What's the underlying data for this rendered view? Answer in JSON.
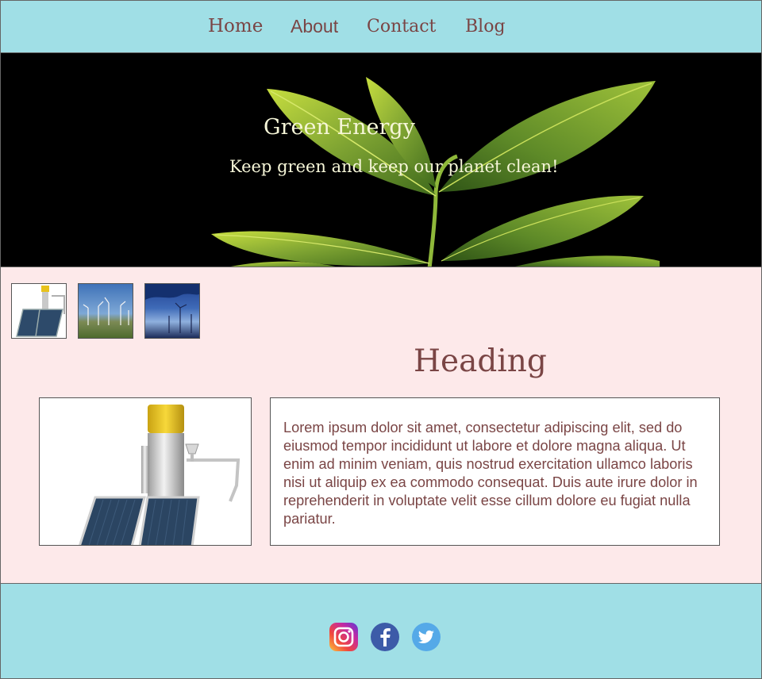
{
  "nav": {
    "items": [
      {
        "label": "Home"
      },
      {
        "label": "About"
      },
      {
        "label": "Contact"
      },
      {
        "label": "Blog"
      }
    ]
  },
  "hero": {
    "title": "Green Energy",
    "subtitle": "Keep green and keep our planet clean!",
    "colors": {
      "background": "#000000",
      "leaf": "#7aa02c",
      "text": "#f6f6d8"
    }
  },
  "gallery": {
    "thumbnails": [
      {
        "icon": "solar-water-heater-image"
      },
      {
        "icon": "wind-turbines-field-image"
      },
      {
        "icon": "wind-turbines-dusk-image"
      }
    ]
  },
  "main": {
    "heading": "Heading",
    "image": {
      "icon": "solar-water-heater-image"
    },
    "body": "Lorem ipsum dolor sit amet, consectetur adipiscing elit, sed do eiusmod tempor incididunt ut labore et dolore magna aliqua. Ut enim ad minim veniam, quis nostrud exercitation ullamco laboris nisi ut aliquip ex ea commodo consequat. Duis aute irure dolor in reprehenderit in voluptate velit esse cillum dolore eu fugiat nulla pariatur."
  },
  "footer": {
    "social": [
      {
        "icon": "instagram-icon"
      },
      {
        "icon": "facebook-icon"
      },
      {
        "icon": "twitter-icon"
      }
    ]
  },
  "colors": {
    "nav_bg": "#a0dfe6",
    "main_bg": "#fde9ea",
    "text": "#7a4545"
  }
}
